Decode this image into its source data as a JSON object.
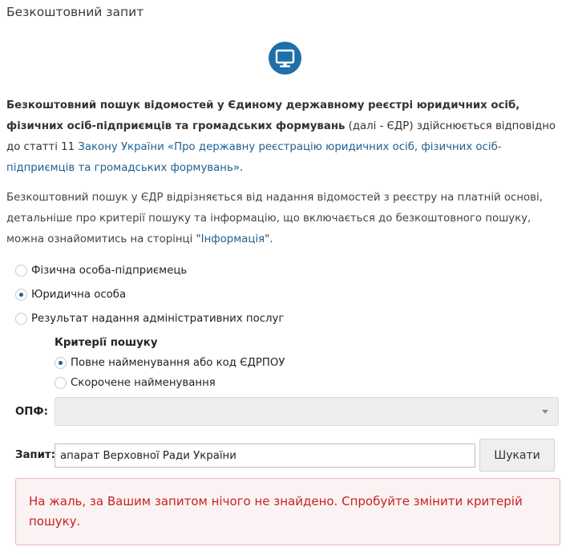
{
  "page": {
    "title": "Безкоштовний запит"
  },
  "logo": {
    "icon": "monitor-icon",
    "color": "#1f6fa9"
  },
  "intro": {
    "bold": "Безкоштовний пошук відомостей у Єдиному державному реєстрі юридичних осіб, фізичних осіб-підприємців та громадських формувань",
    "text": " (далі - ЄДР) здійснюється відповідно до статті 11 ",
    "link": "Закону України «Про державну реєстрацію юридичних осіб, фізичних осіб-підприємців та громадських формувань»",
    "end": "."
  },
  "para2": {
    "text": "Безкоштовний пошук у ЄДР відрізняється від надання відомостей з реєстру на платній основі, детальніше про критерії пошуку та інформацію, що включається до безкоштовного пошуку, можна ознайомитись на сторінці \"",
    "link": "Інформація",
    "end": "\"."
  },
  "entity_type": {
    "options": [
      {
        "label": "Фізична особа-підприємець",
        "checked": false
      },
      {
        "label": "Юридична особа",
        "checked": true
      },
      {
        "label": "Результат надання адміністративних послуг",
        "checked": false
      }
    ]
  },
  "criteria": {
    "title": "Критерії пошуку",
    "options": [
      {
        "label": "Повне найменування або код ЄДРПОУ",
        "checked": true
      },
      {
        "label": "Скорочене найменування",
        "checked": false
      }
    ]
  },
  "opf": {
    "label": "ОПФ:",
    "value": ""
  },
  "query": {
    "label": "Запит:",
    "value": "апарат Верховної Ради України",
    "button": "Шукати"
  },
  "alert": {
    "text": "На жаль, за Вашим запитом нічого не знайдено. Спробуйте змінити критерій пошуку.",
    "color": "#c82020"
  }
}
